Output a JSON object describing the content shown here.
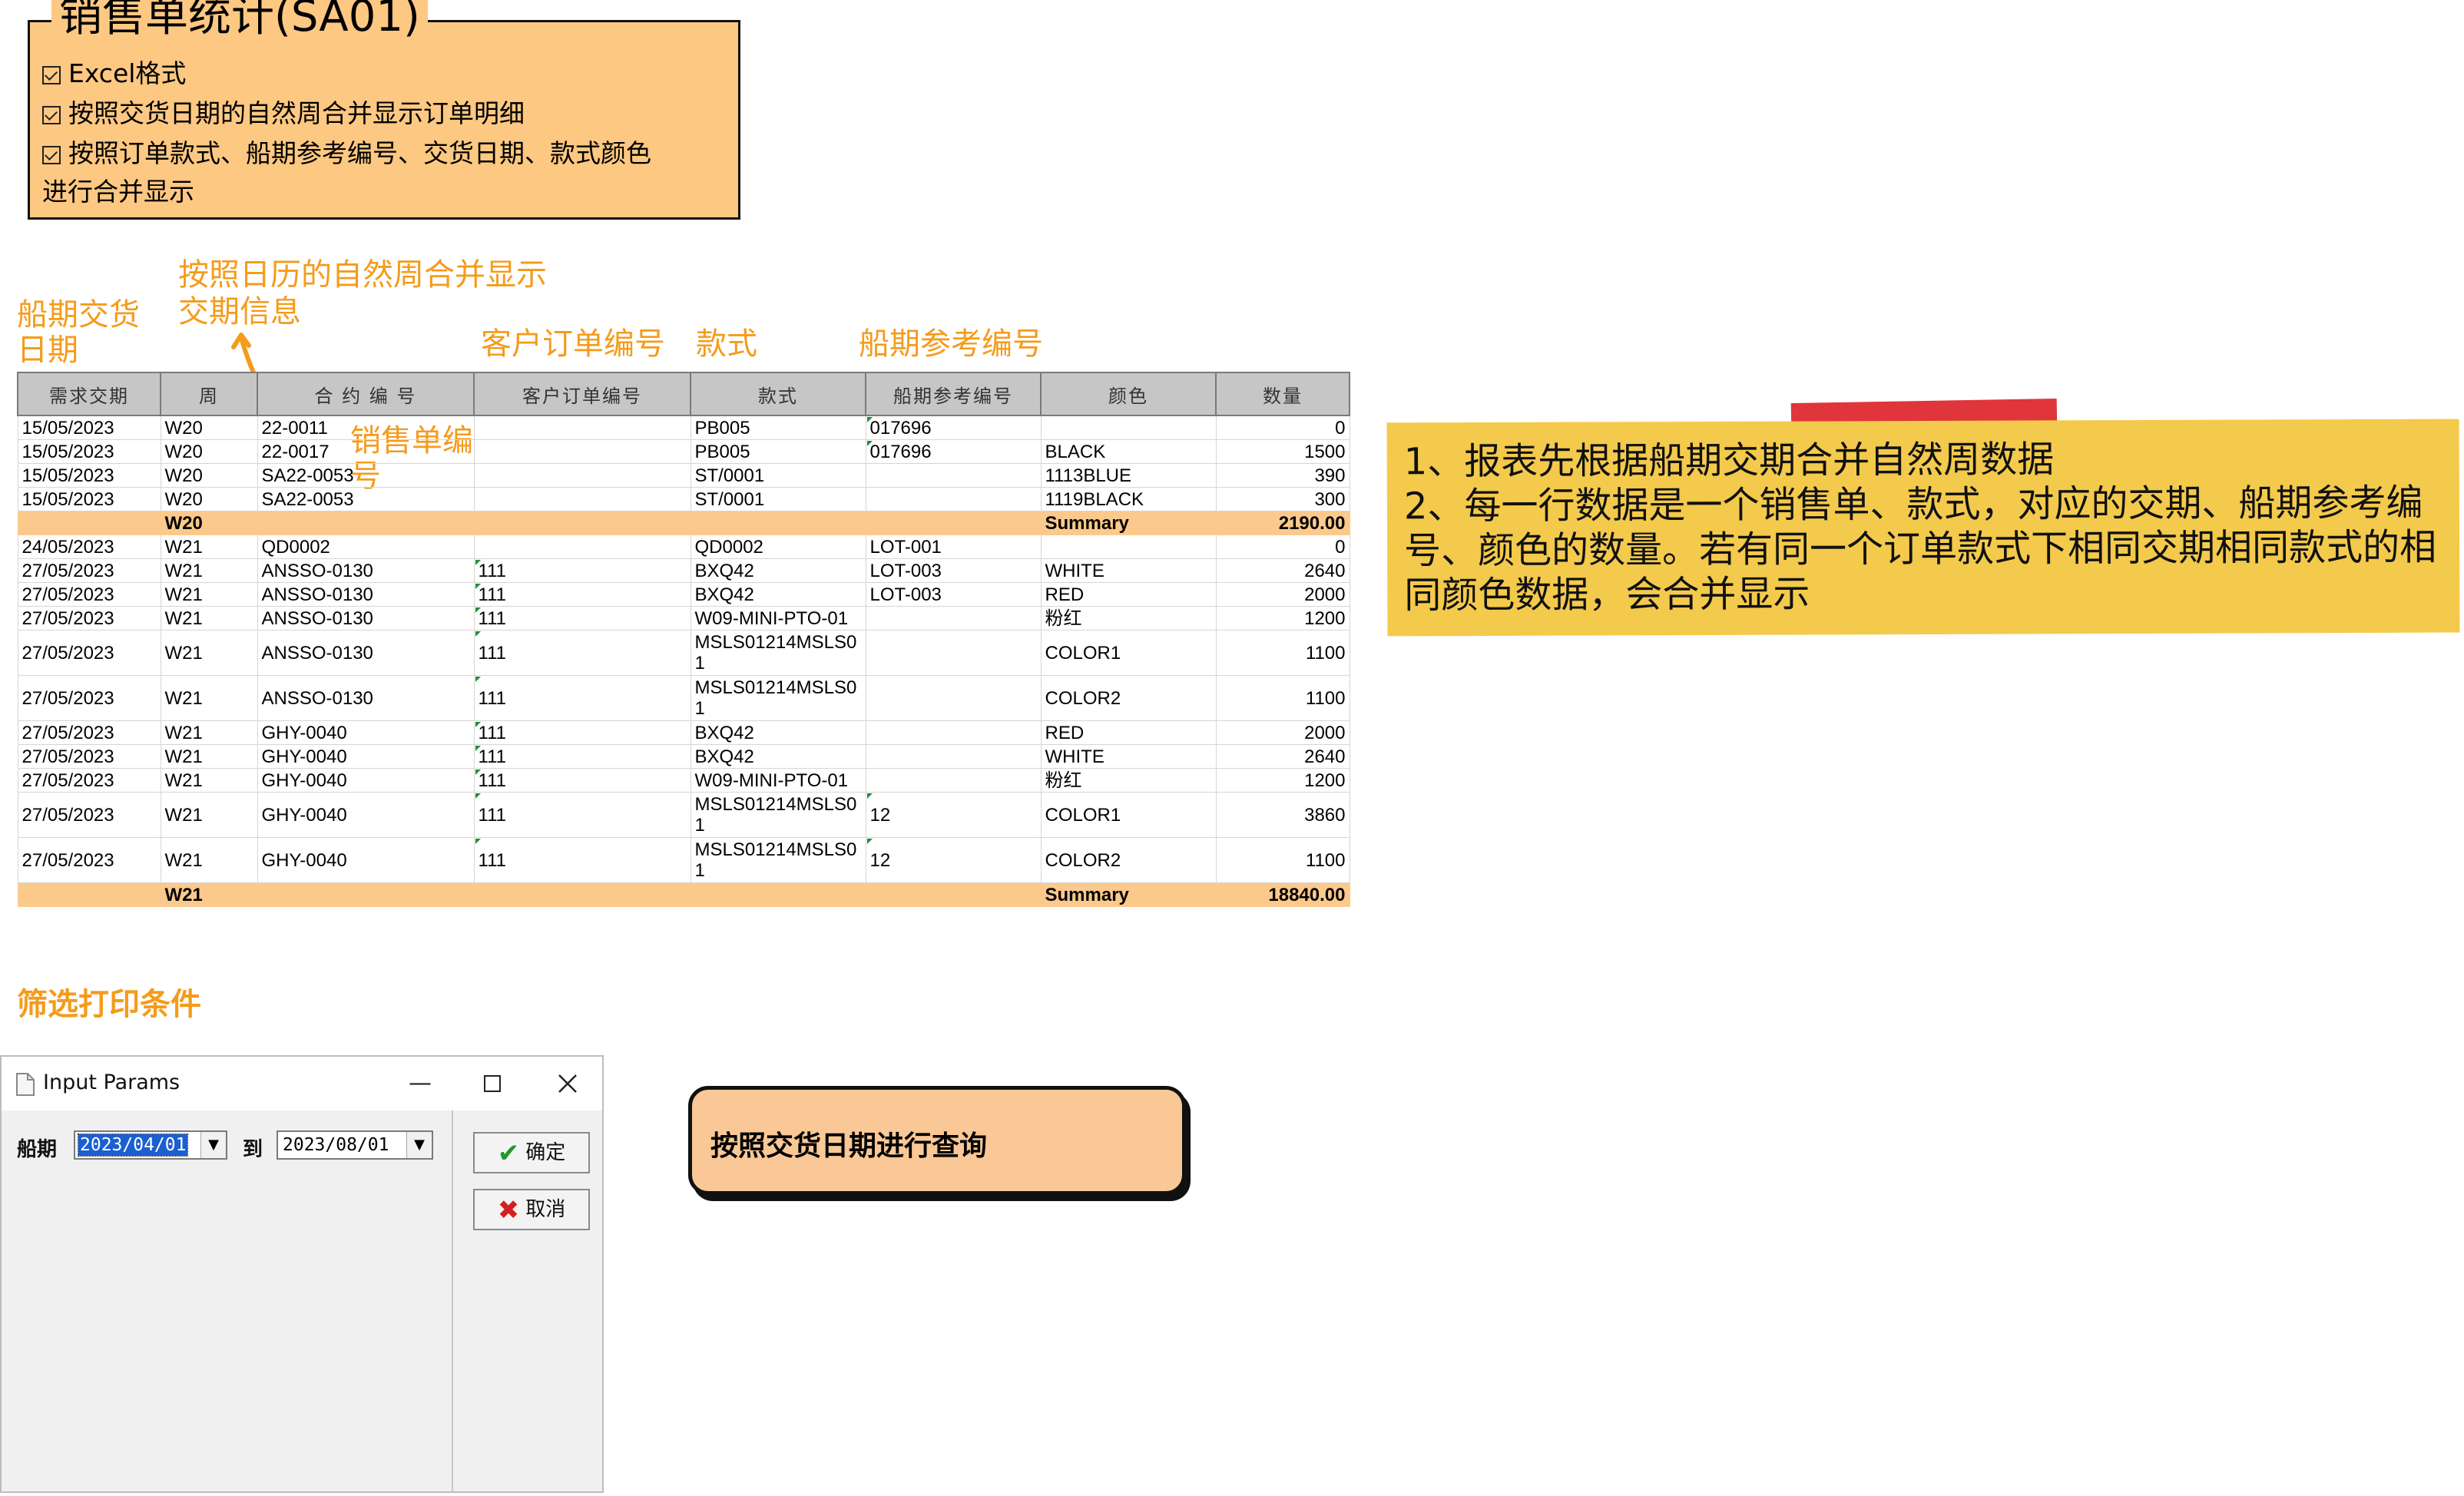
{
  "title_box": {
    "title": "销售单统计(SA01)",
    "options": [
      "Excel格式",
      "按照交货日期的自然周合并显示订单明细",
      "按照订单款式、船期参考编号、交货日期、款式颜色",
      "进行合并显示"
    ]
  },
  "annotations": {
    "ship_date": "船期交货",
    "ship_date_2": "日期",
    "week_merge": "按照日历的自然周合并显示",
    "week_merge_2": "交期信息",
    "customer_order": "客户订单编号",
    "style": "款式",
    "ship_ref": "船期参考编号",
    "sales_order": "销售单编",
    "sales_order_2": "号",
    "filter": "筛选打印条件"
  },
  "table": {
    "headers": [
      "需求交期",
      "周",
      "合 约 编 号",
      "客户订单编号",
      "款式",
      "船期参考编号",
      "颜色",
      "数量"
    ],
    "rows": [
      {
        "date": "15/05/2023",
        "week": "W20",
        "contract": "22-0011",
        "cust": "",
        "style": "PB005",
        "ref": "017696",
        "color": "",
        "qty": "0"
      },
      {
        "date": "15/05/2023",
        "week": "W20",
        "contract": "22-0017",
        "cust": "",
        "style": "PB005",
        "ref": "017696",
        "color": "BLACK",
        "qty": "1500"
      },
      {
        "date": "15/05/2023",
        "week": "W20",
        "contract": "SA22-0053",
        "cust": "",
        "style": "ST/0001",
        "ref": "",
        "color": "1113BLUE",
        "qty": "390"
      },
      {
        "date": "15/05/2023",
        "week": "W20",
        "contract": "SA22-0053",
        "cust": "",
        "style": "ST/0001",
        "ref": "",
        "color": "1119BLACK",
        "qty": "300"
      },
      {
        "summary": true,
        "week": "W20",
        "color": "Summary",
        "qty": "2190.00"
      },
      {
        "date": "24/05/2023",
        "week": "W21",
        "contract": "QD0002",
        "cust": "",
        "style": "QD0002",
        "ref": "LOT-001",
        "color": "",
        "qty": "0"
      },
      {
        "date": "27/05/2023",
        "week": "W21",
        "contract": "ANSSO-0130",
        "cust": "111",
        "style": "BXQ42",
        "ref": "LOT-003",
        "color": "WHITE",
        "qty": "2640"
      },
      {
        "date": "27/05/2023",
        "week": "W21",
        "contract": "ANSSO-0130",
        "cust": "111",
        "style": "BXQ42",
        "ref": "LOT-003",
        "color": "RED",
        "qty": "2000"
      },
      {
        "date": "27/05/2023",
        "week": "W21",
        "contract": "ANSSO-0130",
        "cust": "111",
        "style": "W09-MINI-PTO-01",
        "ref": "",
        "color": "粉红",
        "qty": "1200"
      },
      {
        "tall": true,
        "date": "27/05/2023",
        "week": "W21",
        "contract": "ANSSO-0130",
        "cust": "111",
        "style": "MSLS01214MSLS01",
        "ref": "",
        "color": "COLOR1",
        "qty": "1100"
      },
      {
        "tall": true,
        "date": "27/05/2023",
        "week": "W21",
        "contract": "ANSSO-0130",
        "cust": "111",
        "style": "MSLS01214MSLS01",
        "ref": "",
        "color": "COLOR2",
        "qty": "1100"
      },
      {
        "date": "27/05/2023",
        "week": "W21",
        "contract": "GHY-0040",
        "cust": "111",
        "style": "BXQ42",
        "ref": "",
        "color": "RED",
        "qty": "2000"
      },
      {
        "date": "27/05/2023",
        "week": "W21",
        "contract": "GHY-0040",
        "cust": "111",
        "style": "BXQ42",
        "ref": "",
        "color": "WHITE",
        "qty": "2640"
      },
      {
        "date": "27/05/2023",
        "week": "W21",
        "contract": "GHY-0040",
        "cust": "111",
        "style": "W09-MINI-PTO-01",
        "ref": "",
        "color": "粉红",
        "qty": "1200"
      },
      {
        "tall": true,
        "date": "27/05/2023",
        "week": "W21",
        "contract": "GHY-0040",
        "cust": "111",
        "style": "MSLS01214MSLS01",
        "ref": "12",
        "color": "COLOR1",
        "qty": "3860"
      },
      {
        "tall": true,
        "date": "27/05/2023",
        "week": "W21",
        "contract": "GHY-0040",
        "cust": "111",
        "style": "MSLS01214MSLS01",
        "ref": "12",
        "color": "COLOR2",
        "qty": "1100"
      },
      {
        "summary": true,
        "week": "W21",
        "color": "Summary",
        "qty": "18840.00"
      }
    ]
  },
  "note": {
    "lines": [
      "1、报表先根据船期交期合并自然周数据",
      "2、每一行数据是一个销售单、款式，对应的交期、船期参考编",
      "号、颜色的数量。若有同一个订单款式下相同交期相同款式的相",
      "同颜色数据，会合并显示"
    ]
  },
  "dialog": {
    "title": "Input Params",
    "ship_label": "船期",
    "to_label": "到",
    "date_from": "2023/04/01",
    "date_to": "2023/08/01",
    "ok_label": "确定",
    "cancel_label": "取消"
  },
  "callout": {
    "text": "按照交货日期进行查询"
  },
  "colors": {
    "orange_text": "#f59b1b",
    "title_box_bg": "#fdc882",
    "summary_row": "#fcc98c",
    "note_bg": "#f4ca4c",
    "tape_red": "#e0353a"
  }
}
